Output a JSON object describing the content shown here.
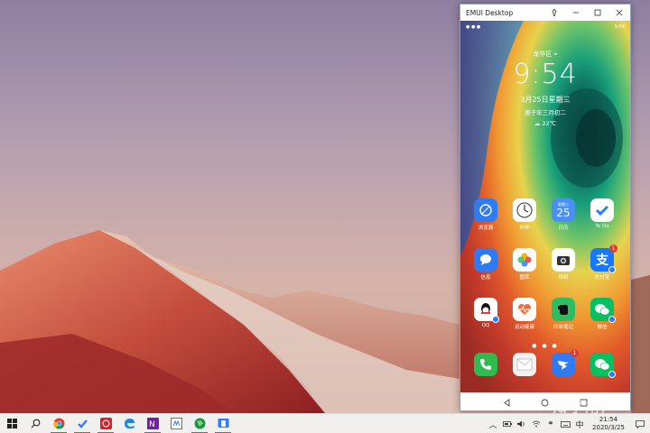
{
  "window": {
    "title": "EMUI Desktop",
    "controls": [
      "pin",
      "minimize",
      "maximize",
      "close"
    ]
  },
  "phone": {
    "status_left": "● ● ●",
    "status_right": "9:54",
    "location": "龙华区",
    "time": "9:54",
    "date": "3月25日星期三",
    "lunar": "庚子年三月初二",
    "weather": "22℃",
    "apps_row1": [
      {
        "label": "浏览器",
        "icon": "browser-icon",
        "color": "#2f7bf5"
      },
      {
        "label": "时钟",
        "icon": "clock-icon",
        "color": "#ffffff"
      },
      {
        "label": "日历",
        "icon": "calendar-icon",
        "color": "#4a90f2",
        "day": "25",
        "weekday": "星期三"
      },
      {
        "label": "To Do",
        "icon": "todo-icon",
        "color": "#ffffff"
      }
    ],
    "apps_row2": [
      {
        "label": "信息",
        "icon": "messages-icon",
        "color": "#2f7bf5"
      },
      {
        "label": "图库",
        "icon": "gallery-icon",
        "color": "#ffffff"
      },
      {
        "label": "相机",
        "icon": "camera-icon",
        "color": "#ffffff"
      },
      {
        "label": "支付宝",
        "icon": "alipay-icon",
        "color": "#1677ff",
        "badge": "1"
      }
    ],
    "apps_row3": [
      {
        "label": "QQ",
        "icon": "qq-icon",
        "color": "#ffffff"
      },
      {
        "label": "运动健康",
        "icon": "health-icon",
        "color": "#ffffff"
      },
      {
        "label": "印象笔记",
        "icon": "evernote-icon",
        "color": "#2dbe60"
      },
      {
        "label": "微信",
        "icon": "wechat-icon",
        "color": "#07c160"
      }
    ],
    "dock": [
      {
        "label": "",
        "icon": "phone-icon",
        "color": "#2fbb4f"
      },
      {
        "label": "",
        "icon": "mail-icon",
        "color": "#f1f1f1"
      },
      {
        "label": "",
        "icon": "dingtalk-icon",
        "color": "#2f7bf5",
        "badge": "1"
      },
      {
        "label": "",
        "icon": "wechat-icon",
        "color": "#07c160"
      }
    ],
    "page_dots": "● ● ●"
  },
  "navbar": [
    "back-icon",
    "home-icon",
    "recents-icon"
  ],
  "taskbar": {
    "clock_time": "21:54",
    "clock_date": "2020/3/25",
    "ime": "中",
    "apps": [
      "start-icon",
      "search-icon",
      "chrome-icon",
      "todo-icon",
      "netease-music-icon",
      "edge-icon",
      "onenote-icon",
      "app-icon",
      "maps-icon",
      "emui-icon"
    ]
  },
  "watermark": "知乎用户"
}
